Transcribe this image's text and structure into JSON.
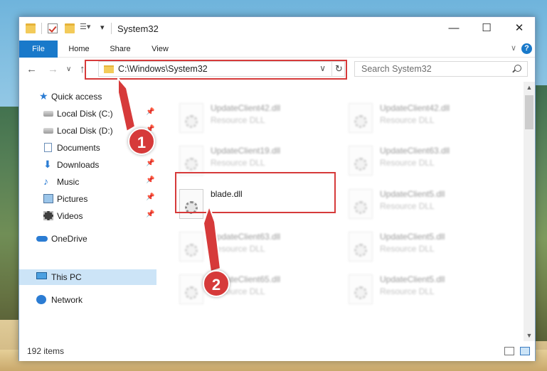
{
  "window": {
    "title": "System32",
    "buttons": {
      "minimize": "—",
      "maximize": "☐",
      "close": "✕"
    }
  },
  "ribbon": {
    "tabs": [
      "File",
      "Home",
      "Share",
      "View"
    ],
    "help": "?"
  },
  "address": {
    "path": "C:\\Windows\\System32",
    "search_placeholder": "Search System32"
  },
  "sidebar": {
    "items": [
      {
        "label": "Quick access",
        "icon": "star-icon"
      },
      {
        "label": "Local Disk (C:)",
        "icon": "disk-icon",
        "pinned": true
      },
      {
        "label": "Local Disk (D:)",
        "icon": "disk-icon",
        "pinned": true
      },
      {
        "label": "Documents",
        "icon": "documents-icon",
        "pinned": true
      },
      {
        "label": "Downloads",
        "icon": "download-icon",
        "pinned": true
      },
      {
        "label": "Music",
        "icon": "music-icon",
        "pinned": true
      },
      {
        "label": "Pictures",
        "icon": "pictures-icon",
        "pinned": true
      },
      {
        "label": "Videos",
        "icon": "videos-icon",
        "pinned": true
      },
      {
        "label": "OneDrive",
        "icon": "cloud-icon"
      },
      {
        "label": "This PC",
        "icon": "pc-icon",
        "selected": true
      },
      {
        "label": "Network",
        "icon": "network-icon"
      }
    ]
  },
  "files": [
    {
      "name": "UpdateClient42.dll",
      "type": "Resource DLL"
    },
    {
      "name": "UpdateClient42.dll",
      "type": "Resource DLL"
    },
    {
      "name": "UpdateClient19.dll",
      "type": "Resource DLL"
    },
    {
      "name": "UpdateClient63.dll",
      "type": "Resource DLL"
    },
    {
      "name": "blade.dll",
      "type": ""
    },
    {
      "name": "UpdateClient5.dll",
      "type": "Resource DLL"
    },
    {
      "name": "UpdateClient63.dll",
      "type": "Resource DLL"
    },
    {
      "name": "UpdateClient5.dll",
      "type": "Resource DLL"
    },
    {
      "name": "UpdateClient65.dll",
      "type": "Resource DLL"
    },
    {
      "name": "UpdateClient5.dll",
      "type": "Resource DLL"
    }
  ],
  "status": {
    "count": "192 items"
  },
  "annotations": {
    "callout1": "1",
    "callout2": "2"
  },
  "colors": {
    "accent": "#1979ca",
    "highlight": "#d63a3a",
    "selected": "#cce4f7"
  }
}
